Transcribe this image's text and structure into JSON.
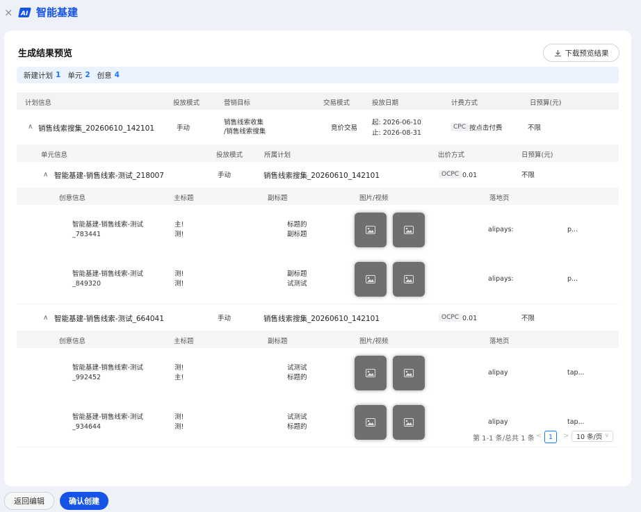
{
  "topbar": {
    "close_glyph": "×",
    "brand_logo": "AI",
    "brand_title": "智能基建"
  },
  "card": {
    "title": "生成结果预览",
    "download_label": "下载预览结果"
  },
  "summary": {
    "plan_label": "新建计划",
    "plan_count": "1",
    "unit_label": "单元",
    "unit_count": "2",
    "creative_label": "创意",
    "creative_count": "4"
  },
  "plan_header": [
    "计划信息",
    "投放模式",
    "营销目标",
    "交易模式",
    "投放日期",
    "计费方式",
    "日预算(元)"
  ],
  "plan": {
    "name": "销售线索搜集_20260610_142101",
    "mode": "手动",
    "goal_line1": "销售线索收集",
    "goal_line2": "/销售线索搜集",
    "trade_mode": "竞价交易",
    "start_date": "起: 2026-06-10",
    "end_date": "止: 2026-08-31",
    "billing_tag": "CPC",
    "billing_text": "按点击付费",
    "budget": "不限"
  },
  "unit_header": [
    "单元信息",
    "投放模式",
    "所属计划",
    "出价方式",
    "日预算(元)"
  ],
  "creative_header": [
    "创意信息",
    "主标题",
    "副标题",
    "图片/视频",
    "落地页"
  ],
  "units": [
    {
      "name": "智能基建-销售线索-测试_218007",
      "mode": "手动",
      "plan": "销售线索搜集_20260610_142101",
      "bid_tag": "OCPC",
      "bid_value": "0.01",
      "budget": "不限",
      "creatives": [
        {
          "name1": "智能基建-销售线索-测试",
          "name2": "_783441",
          "title1": "主!",
          "title2": "测!",
          "sub1": "标题的",
          "sub2": "副标题",
          "landing": "alipays:",
          "landing2": "p..."
        },
        {
          "name1": "智能基建-销售线索-测试",
          "name2": "_849320",
          "title1": "测!",
          "title2": "测!",
          "sub1": "副标题",
          "sub2": "试测试",
          "landing": "alipays:",
          "landing2": "p..."
        }
      ]
    },
    {
      "name": "智能基建-销售线索-测试_664041",
      "mode": "手动",
      "plan": "销售线索搜集_20260610_142101",
      "bid_tag": "OCPC",
      "bid_value": "0.01",
      "budget": "不限",
      "creatives": [
        {
          "name1": "智能基建-销售线索-测试",
          "name2": "_992452",
          "title1": "测!",
          "title2": "主!",
          "sub1": "试测试",
          "sub2": "标题的",
          "landing": "alipay",
          "landing2": "tap..."
        },
        {
          "name1": "智能基建-销售线索-测试",
          "name2": "_934644",
          "title1": "测!",
          "title2": "测!",
          "sub1": "试测试",
          "sub2": "标题的",
          "landing": "alipay",
          "landing2": "tap..."
        }
      ]
    }
  ],
  "pagination": {
    "summary": "第 1-1 条/总共 1 条",
    "current": "1",
    "page_size": "10 条/页"
  },
  "footer": {
    "back_label": "返回编辑",
    "confirm_label": "确认创建"
  },
  "colors": {
    "accent": "#1554e6",
    "link": "#1677ff",
    "background": "#eef1f7"
  }
}
